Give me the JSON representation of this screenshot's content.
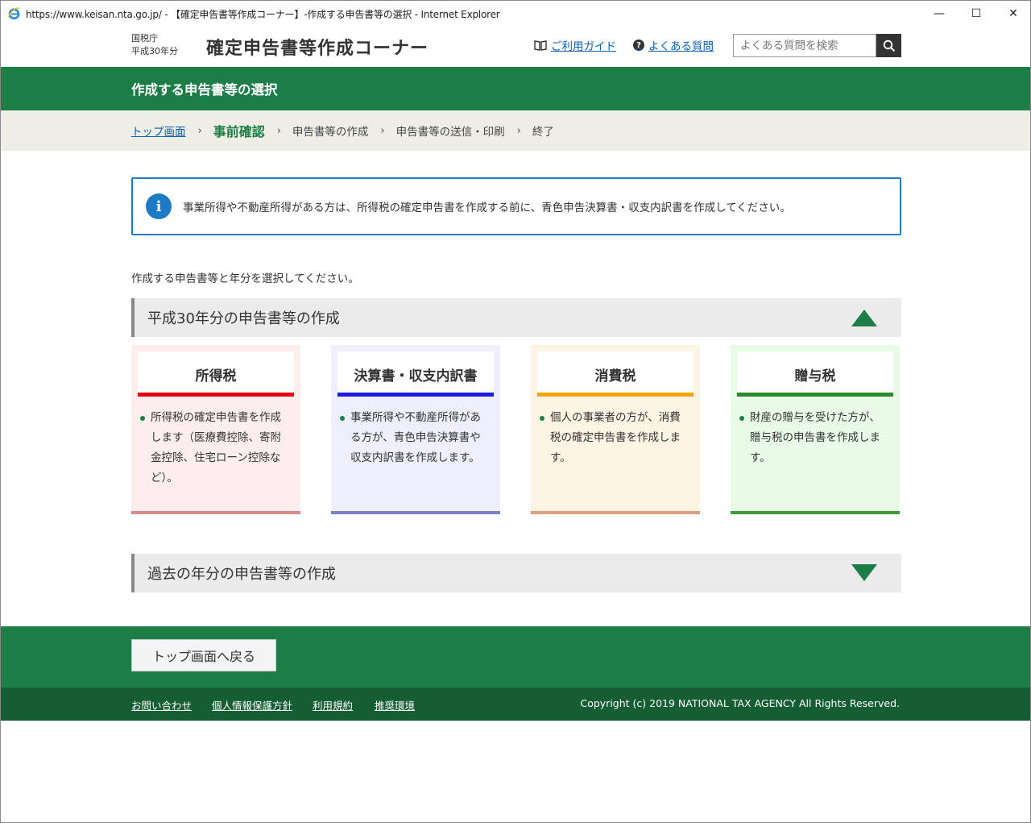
{
  "window": {
    "title": "https://www.keisan.nta.go.jp/ - 【確定申告書等作成コーナー】-作成する申告書等の選択 - Internet Explorer",
    "min": "—",
    "max": "☐",
    "close": "✕"
  },
  "header": {
    "agency": "国税庁",
    "year": "平成30年分",
    "corner_title": "確定申告書等作成コーナー",
    "guide_link": "ご利用ガイド",
    "faq_link": "よくある質問",
    "search_placeholder": "よくある質問を検索"
  },
  "page_title": "作成する申告書等の選択",
  "breadcrumb": {
    "top": "トップ画面",
    "current": "事前確認",
    "step3": "申告書等の作成",
    "step4": "申告書等の送信・印刷",
    "step5": "終了",
    "sep": "›"
  },
  "info": {
    "icon": "i",
    "text": "事業所得や不動産所得がある方は、所得税の確定申告書を作成する前に、青色申告決算書・収支内訳書を作成してください。"
  },
  "lead": "作成する申告書等と年分を選択してください。",
  "section_current": {
    "title": "平成30年分の申告書等の作成"
  },
  "cards": [
    {
      "title": "所得税",
      "desc": "所得税の確定申告書を作成します（医療費控除、寄附金控除、住宅ローン控除など）。",
      "bg": "#fdeeee",
      "bar": "#e60012",
      "bottom": "#d98a8a"
    },
    {
      "title": "決算書・収支内訳書",
      "desc": "事業所得や不動産所得がある方が、青色申告決算書や収支内訳書を作成します。",
      "bg": "#eeeefc",
      "bar": "#1a1ae0",
      "bottom": "#7f7fcc"
    },
    {
      "title": "消費税",
      "desc": "個人の事業者の方が、消費税の確定申告書を作成します。",
      "bg": "#fdf4e4",
      "bar": "#f3a600",
      "bottom": "#e0a080"
    },
    {
      "title": "贈与税",
      "desc": "財産の贈与を受けた方が、贈与税の申告書を作成します。",
      "bg": "#e8fbe6",
      "bar": "#2a8a2a",
      "bottom": "#3d9a3d"
    }
  ],
  "section_past": {
    "title": "過去の年分の申告書等の作成"
  },
  "footer": {
    "back_button": "トップ画面へ戻る",
    "links": [
      "お問い合わせ",
      "個人情報保護方針",
      "利用規約",
      "推奨環境"
    ],
    "copyright": "Copyright (c) 2019 NATIONAL TAX AGENCY All Rights Reserved."
  }
}
